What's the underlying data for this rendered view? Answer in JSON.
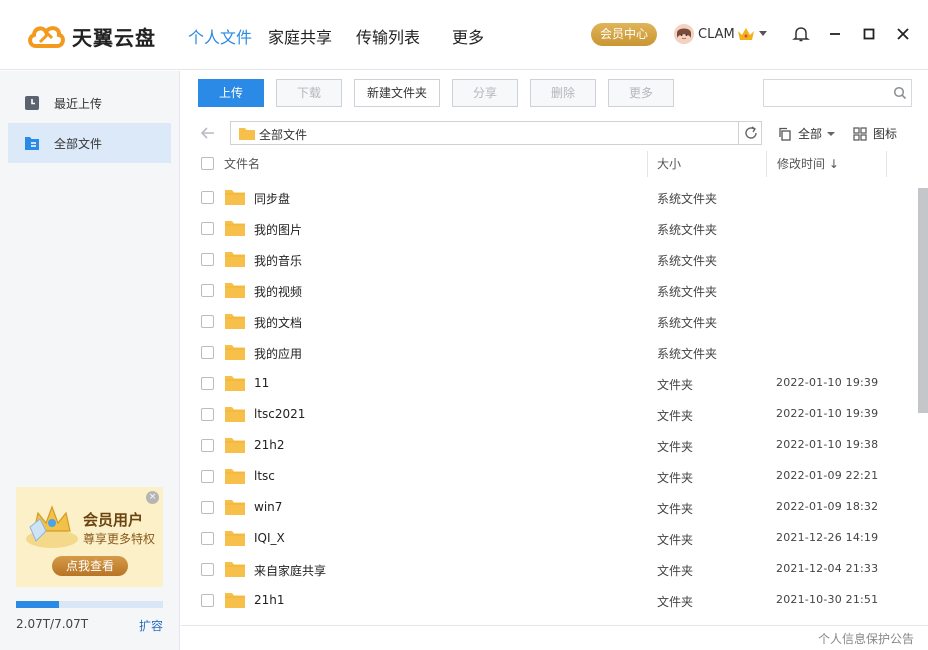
{
  "app": {
    "name": "天翼云盘"
  },
  "nav": {
    "tabs": [
      "个人文件",
      "家庭共享",
      "传输列表",
      "更多"
    ],
    "active": "个人文件"
  },
  "user": {
    "vip_label": "会员中心",
    "name": "CLAM"
  },
  "sidebar": {
    "items": [
      {
        "label": "最近上传",
        "icon": "clock-icon"
      },
      {
        "label": "全部文件",
        "icon": "folder-list-icon",
        "active": true
      }
    ],
    "promo": {
      "title": "会员用户",
      "subtitle": "尊享更多特权",
      "button": "点我查看"
    },
    "storage": {
      "used": "2.07T",
      "total": "7.07T",
      "text": "2.07T/7.07T",
      "fraction": 0.29,
      "expand_label": "扩容"
    }
  },
  "toolbar": {
    "upload": "上传",
    "download": "下载",
    "new_folder": "新建文件夹",
    "share": "分享",
    "delete": "删除",
    "more": "更多",
    "search_placeholder": ""
  },
  "path": {
    "current": "全部文件",
    "filter_label": "全部",
    "view_label": "图标"
  },
  "list": {
    "columns": {
      "name": "文件名",
      "size": "大小",
      "modified": "修改时间 ↓"
    },
    "rows": [
      {
        "name": "同步盘",
        "type": "系统文件夹",
        "date": ""
      },
      {
        "name": "我的图片",
        "type": "系统文件夹",
        "date": ""
      },
      {
        "name": "我的音乐",
        "type": "系统文件夹",
        "date": ""
      },
      {
        "name": "我的视频",
        "type": "系统文件夹",
        "date": ""
      },
      {
        "name": "我的文档",
        "type": "系统文件夹",
        "date": ""
      },
      {
        "name": "我的应用",
        "type": "系统文件夹",
        "date": ""
      },
      {
        "name": "11",
        "type": "文件夹",
        "date": "2022-01-10  19:39"
      },
      {
        "name": "ltsc2021",
        "type": "文件夹",
        "date": "2022-01-10  19:39"
      },
      {
        "name": "21h2",
        "type": "文件夹",
        "date": "2022-01-10  19:38"
      },
      {
        "name": "ltsc",
        "type": "文件夹",
        "date": "2022-01-09  22:21"
      },
      {
        "name": "win7",
        "type": "文件夹",
        "date": "2022-01-09  18:32"
      },
      {
        "name": "IQI_X",
        "type": "文件夹",
        "date": "2021-12-26  14:19"
      },
      {
        "name": "来自家庭共享",
        "type": "文件夹",
        "date": "2021-12-04  21:33"
      },
      {
        "name": "21h1",
        "type": "文件夹",
        "date": "2021-10-30  21:51"
      }
    ]
  },
  "footer": {
    "privacy": "个人信息保护公告"
  },
  "colors": {
    "accent": "#2b8ae6",
    "folder": "#f7c04a",
    "vip_gold": "#d3a546"
  }
}
